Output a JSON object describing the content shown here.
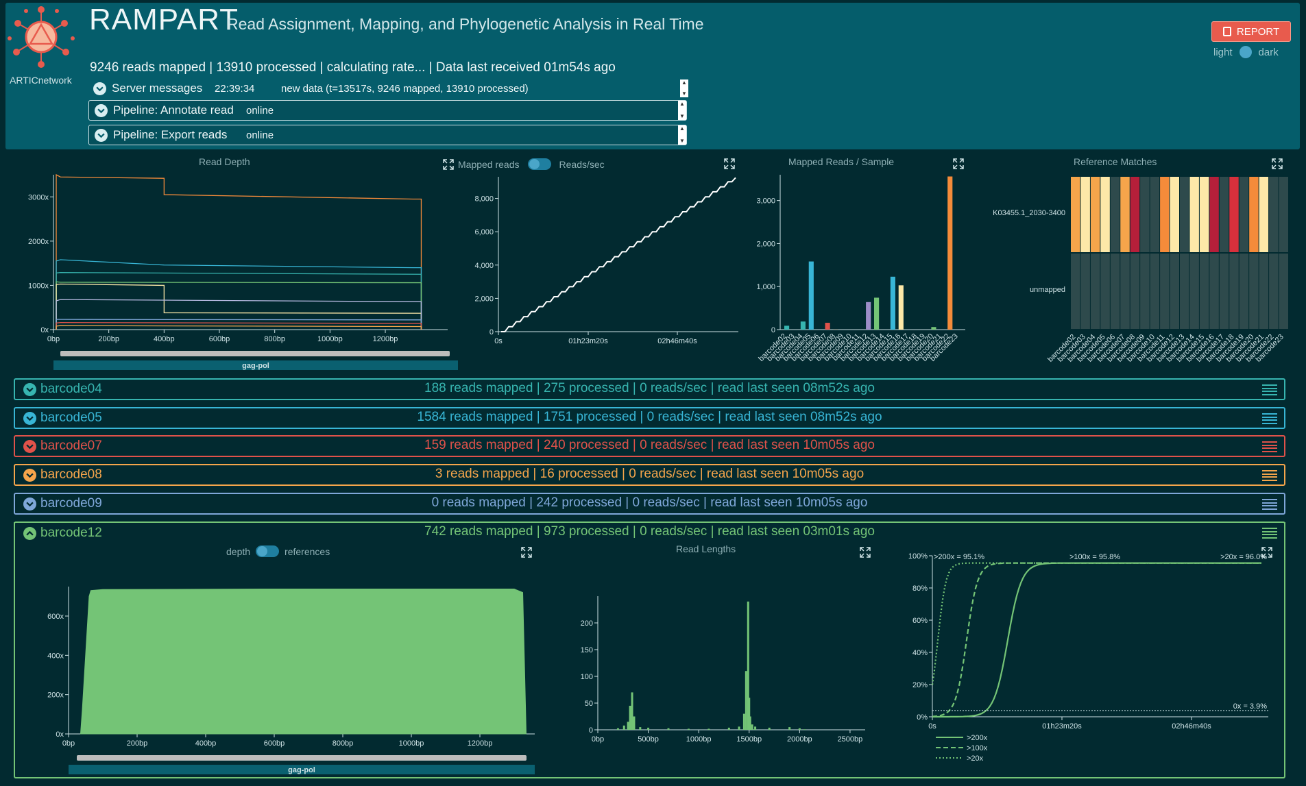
{
  "header": {
    "title": "RAMPART",
    "subtitle": "Read Assignment, Mapping, and Phylogenetic Analysis in Real Time",
    "logo_text": "ARTICnetwork",
    "summary": "9246 reads mapped | 13910 processed | calculating rate... | Data last received 01m54s ago",
    "report_label": "REPORT",
    "theme_light": "light",
    "theme_dark": "dark"
  },
  "server": {
    "label": "Server messages",
    "time": "22:39:34",
    "message": "new data (t=13517s, 9246 mapped, 13910 processed)"
  },
  "pipelines": [
    {
      "name": "Pipeline: Annotate reads",
      "status": "online"
    },
    {
      "name": "Pipeline: Export reads",
      "status": "online"
    }
  ],
  "panels": {
    "read_depth_title": "Read Depth",
    "mapped_toggle_left": "Mapped reads",
    "mapped_toggle_right": "Reads/sec",
    "mapped_per_sample_title": "Mapped Reads / Sample",
    "ref_matches_title": "Reference Matches",
    "gene_label": "gag-pol"
  },
  "colors": {
    "barcode04": "#37b5b0",
    "barcode05": "#38b6d6",
    "barcode07": "#e0524a",
    "barcode08": "#f5a54b",
    "barcode09": "#7fa7d9",
    "barcode12": "#74c476",
    "orange": "#f58b3a",
    "cream": "#fde8a8",
    "red": "#d7303c",
    "dark_red": "#b51f3a"
  },
  "barcodes": [
    {
      "name": "barcode04",
      "stats": "188 reads mapped | 275 processed | 0 reads/sec | read last seen 08m52s ago",
      "expanded": false
    },
    {
      "name": "barcode05",
      "stats": "1584 reads mapped | 1751 processed | 0 reads/sec | read last seen 08m52s ago",
      "expanded": false
    },
    {
      "name": "barcode07",
      "stats": "159 reads mapped | 240 processed | 0 reads/sec | read last seen 10m05s ago",
      "expanded": false
    },
    {
      "name": "barcode08",
      "stats": "3 reads mapped | 16 processed | 0 reads/sec | read last seen 10m05s ago",
      "expanded": false
    },
    {
      "name": "barcode09",
      "stats": "0 reads mapped | 242 processed | 0 reads/sec | read last seen 10m05s ago",
      "expanded": false
    },
    {
      "name": "barcode12",
      "stats": "742 reads mapped | 973 processed | 0 reads/sec | read last seen 03m01s ago",
      "expanded": true
    }
  ],
  "barcode12_panel": {
    "toggle_left": "depth",
    "toggle_right": "references",
    "read_lengths_title": "Read Lengths",
    "gene_label": "gag-pol"
  },
  "chart_data": [
    {
      "type": "line",
      "title": "Read Depth",
      "xlabel": "",
      "ylabel": "",
      "x_ticks": [
        "0bp",
        "200bp",
        "400bp",
        "600bp",
        "800bp",
        "1000bp",
        "1200bp"
      ],
      "y_ticks": [
        "0x",
        "1000x",
        "2000x",
        "3000x"
      ],
      "xlim": [
        0,
        1340
      ],
      "ylim": [
        0,
        3500
      ],
      "series": [
        {
          "color": "#f58b3a",
          "x": [
            10,
            25,
            400,
            400,
            1300,
            1330
          ],
          "y": [
            3500,
            3450,
            3420,
            3050,
            2950,
            2950
          ]
        },
        {
          "color": "#38b6d6",
          "x": [
            10,
            25,
            400,
            1300,
            1330
          ],
          "y": [
            1550,
            1580,
            1460,
            1400,
            1400
          ]
        },
        {
          "color": "#37b5b0",
          "x": [
            10,
            25,
            1330
          ],
          "y": [
            1280,
            1290,
            1250
          ]
        },
        {
          "color": "#74c476",
          "x": [
            10,
            25,
            1330
          ],
          "y": [
            1080,
            1070,
            1060
          ]
        },
        {
          "color": "#fde8a8",
          "x": [
            10,
            25,
            400,
            400,
            1330
          ],
          "y": [
            1020,
            1030,
            1000,
            380,
            370
          ]
        },
        {
          "color": "#b6b9e0",
          "x": [
            10,
            25,
            1330
          ],
          "y": [
            650,
            680,
            630
          ]
        },
        {
          "color": "#7fa7d9",
          "x": [
            10,
            25,
            1330
          ],
          "y": [
            230,
            230,
            220
          ]
        },
        {
          "color": "#e0524a",
          "x": [
            10,
            25,
            1330
          ],
          "y": [
            150,
            160,
            140
          ]
        },
        {
          "color": "#f5a54b",
          "x": [
            10,
            25,
            1330
          ],
          "y": [
            80,
            90,
            70
          ]
        }
      ]
    },
    {
      "type": "line",
      "title": "",
      "x_ticks": [
        "0s",
        "01h23m20s",
        "02h46m40s"
      ],
      "y_ticks": [
        "0",
        "2,000",
        "4,000",
        "6,000",
        "8,000"
      ],
      "xlim": [
        0,
        13517
      ],
      "ylim": [
        0,
        9300
      ],
      "series": [
        {
          "color": "#ffffff",
          "values": [
            0,
            0,
            300,
            300,
            600,
            600,
            900,
            900,
            1200,
            1200,
            1500,
            1500,
            1800,
            1800,
            2100,
            2100,
            2400,
            2400,
            2700,
            2700,
            3000,
            3000,
            3300,
            3300,
            3600,
            3600,
            3900,
            3900,
            4200,
            4200,
            4500,
            4500,
            4800,
            4800,
            5100,
            5100,
            5400,
            5400,
            5700,
            5700,
            6000,
            6000,
            6300,
            6300,
            6600,
            6600,
            6900,
            6900,
            7200,
            7200,
            7500,
            7500,
            7800,
            7800,
            8100,
            8100,
            8400,
            8400,
            8700,
            8700,
            9000,
            9000,
            9246
          ]
        }
      ]
    },
    {
      "type": "bar",
      "title": "Mapped Reads / Sample",
      "categories": [
        "barcode02",
        "barcode03",
        "barcode04",
        "barcode05",
        "barcode06",
        "barcode07",
        "barcode08",
        "barcode09",
        "barcode10",
        "barcode11",
        "barcode12",
        "barcode13",
        "barcode14",
        "barcode15",
        "barcode16",
        "barcode17",
        "barcode18",
        "barcode19",
        "barcode20",
        "barcode21",
        "barcode22",
        "barcode23"
      ],
      "values": [
        90,
        0,
        188,
        1584,
        0,
        159,
        3,
        0,
        0,
        0,
        640,
        742,
        0,
        1230,
        1030,
        0,
        0,
        0,
        60,
        0,
        3560,
        0
      ],
      "colors": [
        "#37b5b0",
        "#37b5b0",
        "#37b5b0",
        "#38b6d6",
        "#38b6d6",
        "#e0524a",
        "#f5a54b",
        "#7fa7d9",
        "#7fa7d9",
        "#b6b9e0",
        "#9d8dc8",
        "#74c476",
        "#74c476",
        "#38b6d6",
        "#fde8a8",
        "#fde8a8",
        "#fde8a8",
        "#74c476",
        "#74c476",
        "#f58b3a",
        "#f58b3a",
        "#f58b3a"
      ],
      "y_ticks": [
        "0",
        "1,000",
        "2,000",
        "3,000"
      ],
      "ylim": [
        0,
        3600
      ]
    },
    {
      "type": "heatmap",
      "title": "Reference Matches",
      "rows": [
        "K03455.1_2030-3400",
        "unmapped"
      ],
      "columns": [
        "barcode02",
        "barcode03",
        "barcode04",
        "barcode05",
        "barcode06",
        "barcode07",
        "barcode08",
        "barcode09",
        "barcode10",
        "barcode11",
        "barcode12",
        "barcode13",
        "barcode14",
        "barcode15",
        "barcode16",
        "barcode17",
        "barcode18",
        "barcode19",
        "barcode20",
        "barcode21",
        "barcode22",
        "barcode23"
      ],
      "top_colors": [
        "#f5a54b",
        "#fde8a8",
        "#f5a54b",
        "#fde8a8",
        "#2e4a4c",
        "#f5a54b",
        "#b51f3a",
        "#2e4a4c",
        "#2e4a4c",
        "#f58b3a",
        "#fde8a8",
        "#2e4a4c",
        "#fde8a8",
        "#fde8a8",
        "#b51f3a",
        "#2e4a4c",
        "#d7303c",
        "#2e4a4c",
        "#f58b3a",
        "#fde8a8",
        "#2e4a4c",
        "#2e4a4c"
      ],
      "bottom_color": "#2e4a4c"
    },
    {
      "type": "area",
      "title": "",
      "x_ticks": [
        "0bp",
        "200bp",
        "400bp",
        "600bp",
        "800bp",
        "1000bp",
        "1200bp"
      ],
      "y_ticks": [
        "0x",
        "200x",
        "400x",
        "600x"
      ],
      "xlim": [
        0,
        1360
      ],
      "ylim": [
        0,
        750
      ],
      "series": [
        {
          "color": "#74c476",
          "x": [
            35,
            40,
            60,
            65,
            100,
            600,
            1300,
            1325,
            1335
          ],
          "y": [
            0,
            120,
            700,
            730,
            735,
            738,
            738,
            720,
            0
          ]
        }
      ]
    },
    {
      "type": "bar",
      "title": "Read Lengths",
      "x_ticks": [
        "0bp",
        "500bp",
        "1000bp",
        "1500bp",
        "2000bp",
        "2500bp"
      ],
      "y_ticks": [
        "0",
        "50",
        "100",
        "150",
        "200"
      ],
      "xlim": [
        0,
        2650
      ],
      "ylim": [
        0,
        250
      ],
      "series": [
        {
          "color": "#74c476",
          "x": [
            200,
            260,
            300,
            320,
            340,
            360,
            420,
            500,
            700,
            900,
            1100,
            1300,
            1400,
            1450,
            1470,
            1490,
            1500,
            1510,
            1530,
            1560,
            1700,
            1900,
            2000,
            2050
          ],
          "values": [
            3,
            8,
            15,
            45,
            70,
            25,
            5,
            4,
            3,
            2,
            2,
            4,
            6,
            30,
            110,
            240,
            60,
            25,
            10,
            6,
            4,
            5,
            3,
            1
          ]
        }
      ]
    },
    {
      "type": "line",
      "title": "",
      "x_ticks": [
        "0s",
        "01h23m20s",
        "02h46m40s"
      ],
      "y_ticks": [
        "0%",
        "20%",
        "40%",
        "60%",
        "80%",
        "100%"
      ],
      "ylim": [
        0,
        100
      ],
      "annotations": [
        ">200x = 95.1%",
        ">100x = 95.8%",
        ">20x = 96.0%",
        "0x = 3.9%"
      ],
      "legend": [
        ">200x",
        ">100x",
        ">20x"
      ],
      "series": [
        {
          "name": ">200x",
          "color": "#74c476",
          "style": "solid"
        },
        {
          "name": ">100x",
          "color": "#74c476",
          "style": "dashed"
        },
        {
          "name": ">20x",
          "color": "#74c476",
          "style": "dotted"
        }
      ]
    }
  ]
}
